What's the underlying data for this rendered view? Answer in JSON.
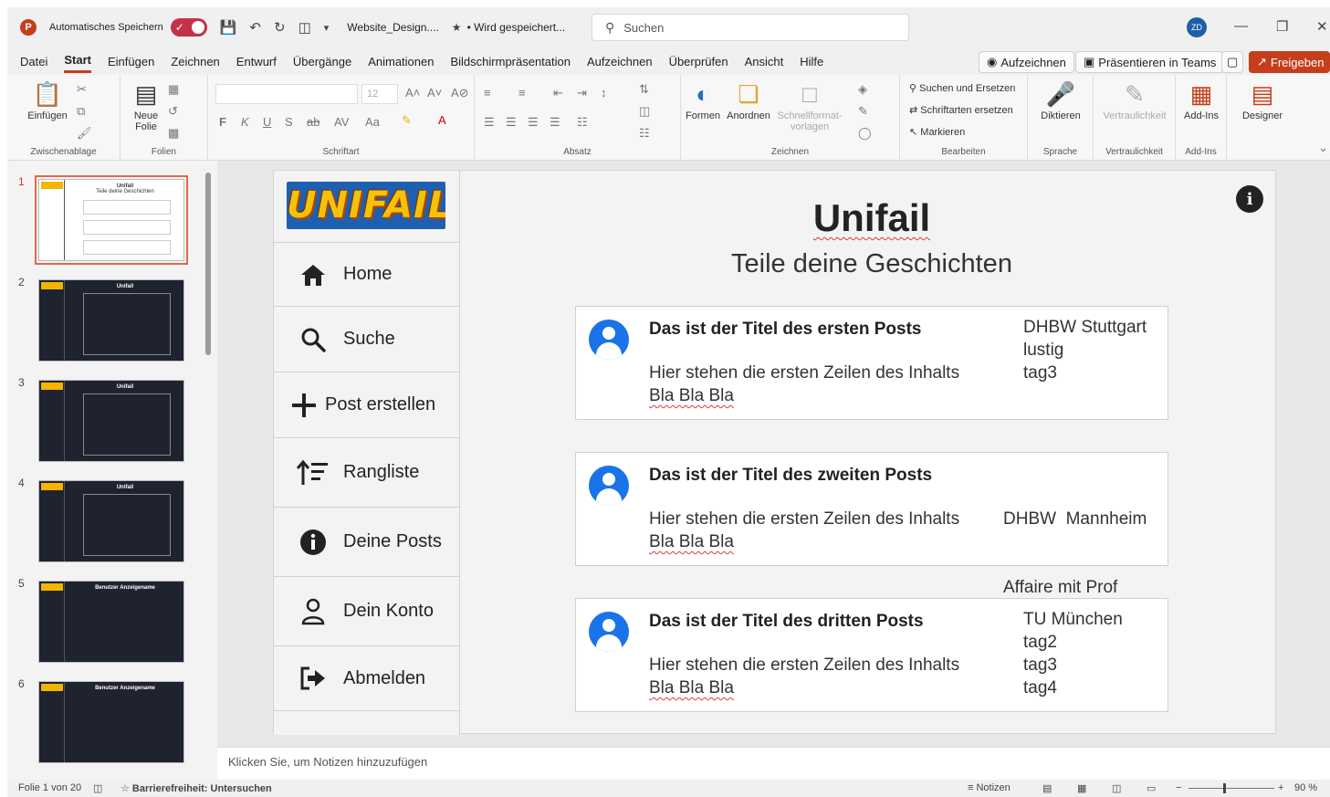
{
  "titlebar": {
    "autosave_label": "Automatisches Speichern",
    "autosave_state": "✓",
    "filename": "Website_Design....",
    "save_status": "• Wird gespeichert...",
    "search_placeholder": "Suchen",
    "user_initials": "ZD"
  },
  "menu": {
    "tabs": [
      "Datei",
      "Start",
      "Einfügen",
      "Zeichnen",
      "Entwurf",
      "Übergänge",
      "Animationen",
      "Bildschirmpräsentation",
      "Aufzeichnen",
      "Überprüfen",
      "Ansicht",
      "Hilfe"
    ],
    "record_btn": "Aufzeichnen",
    "teams_btn": "Präsentieren in Teams",
    "share_btn": "Freigeben"
  },
  "ribbon": {
    "paste": "Einfügen",
    "clipboard_group": "Zwischenablage",
    "new_slide": "Neue Folie",
    "slides_group": "Folien",
    "font_size": "12",
    "font_group": "Schriftart",
    "paragraph_group": "Absatz",
    "shapes": "Formen",
    "arrange": "Anordnen",
    "quick_styles": "Schnellformat-vorlagen",
    "drawing_group": "Zeichnen",
    "find_replace": "Suchen und Ersetzen",
    "replace_fonts": "Schriftarten ersetzen",
    "select": "Markieren",
    "editing_group": "Bearbeiten",
    "dictate": "Diktieren",
    "voice_group": "Sprache",
    "sensitivity": "Vertraulichkeit",
    "sensitivity_group": "Vertraulichkeit",
    "addins": "Add-Ins",
    "addins_group": "Add-Ins",
    "designer": "Designer",
    "font_buttons": [
      "F",
      "K",
      "U",
      "S"
    ]
  },
  "thumbnails": {
    "numbers": [
      "1",
      "2",
      "3",
      "4",
      "5",
      "6"
    ],
    "slide1_title": "Unifail",
    "slide1_sub": "Teile deine Geschichten",
    "dark_titles": [
      "Unifail",
      "Unifail",
      "Unifail",
      "Benutzer Anzeigename",
      "Benutzer Anzeigename"
    ]
  },
  "slide": {
    "logo_text": "UNIFAIL",
    "title": "Unifail",
    "subtitle": "Teile deine Geschichten",
    "nav": [
      "Home",
      "Suche",
      "Post erstellen",
      "Rangliste",
      "Deine Posts",
      "Dein Konto",
      "Abmelden"
    ],
    "posts": [
      {
        "title": "Das ist der Titel des ersten Posts",
        "body1": "Hier stehen die ersten Zeilen des Inhalts",
        "body2": "Bla Bla Bla",
        "tags": [
          "DHBW Stuttgart",
          "lustig",
          "tag3"
        ]
      },
      {
        "title": "Das ist der Titel des zweiten Posts",
        "body1": "Hier stehen die ersten Zeilen des Inhalts",
        "body2": "Bla Bla Bla",
        "tags": [
          "DHBW  Mannheim",
          "Affaire mit Prof"
        ]
      },
      {
        "title": "Das ist der Titel des dritten Posts",
        "body1": "Hier stehen die ersten Zeilen des Inhalts",
        "body2": "Bla Bla Bla",
        "tags": [
          "TU München",
          "tag2",
          "tag3",
          "tag4"
        ]
      }
    ]
  },
  "notes_placeholder": "Klicken Sie, um Notizen hinzuzufügen",
  "status": {
    "slide_count": "Folie 1 von 20",
    "accessibility": "Barrierefreiheit: Untersuchen",
    "notes": "Notizen",
    "zoom": "90 %"
  },
  "colors": {
    "accent": "#c43e1c",
    "avatar_blue": "#1a73e8",
    "logo_yellow": "#f5c20a"
  }
}
